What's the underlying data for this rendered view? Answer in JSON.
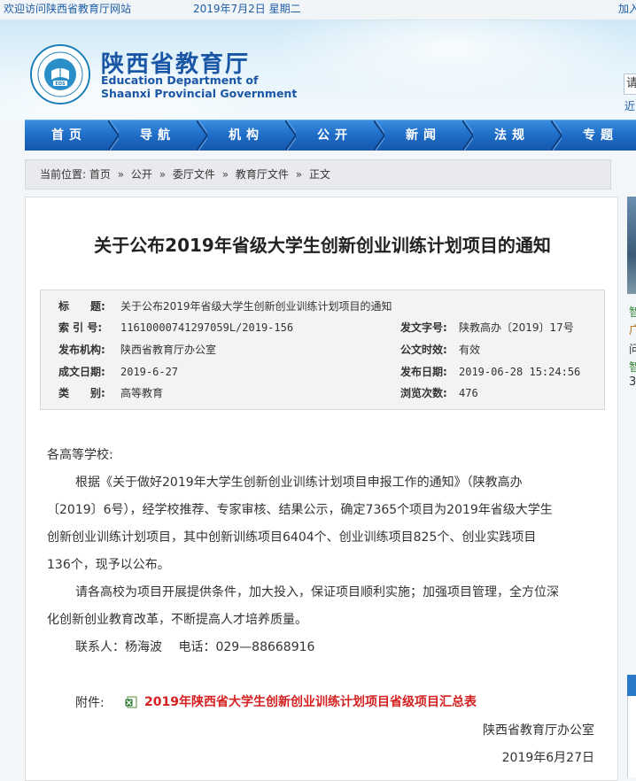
{
  "topbar": {
    "welcome": "欢迎访问陕西省教育厅网站",
    "date": "2019年7月2日 星期二",
    "right_fragment": "加入"
  },
  "header": {
    "site_name_cn": "陕西省教育厅",
    "site_name_en_1": "Education Department of",
    "site_name_en_2": "Shaanxi Provincial Government",
    "logo_text_top": "EDUCATION DEPARTMENT OF SHAANXI",
    "logo_badge": "EDS",
    "logo_text_bottom": "陕西省教育厅",
    "search_fragment": "请",
    "hot_fragment": "近"
  },
  "nav": {
    "items": [
      "首页",
      "导航",
      "机构",
      "公开",
      "新闻",
      "法规",
      "专题"
    ]
  },
  "breadcrumb": {
    "prefix": "当前位置:",
    "items": [
      "首页",
      "公开",
      "委厅文件",
      "教育厅文件",
      "正文"
    ],
    "separator": "»"
  },
  "article": {
    "title": "关于公布2019年省级大学生创新创业训练计划项目的通知",
    "meta": {
      "title_label": "标　　题:",
      "title_value": "关于公布2019年省级大学生创新创业训练计划项目的通知",
      "index_label": "索 引 号:",
      "index_value": "11610000741297059L/2019-156",
      "doc_no_label": "发文字号:",
      "doc_no_value": "陕教高办〔2019〕17号",
      "issuer_label": "发布机构:",
      "issuer_value": "陕西省教育厅办公室",
      "validity_label": "公文时效:",
      "validity_value": "有效",
      "created_label": "成文日期:",
      "created_value": "2019-6-27",
      "published_label": "发布日期:",
      "published_value": "2019-06-28 15:24:56",
      "category_label": "类　　别:",
      "category_value": "高等教育",
      "views_label": "浏览次数:",
      "views_value": "476"
    },
    "body": {
      "salutation": "各高等学校:",
      "p1_l1": "根据《关于做好2019年大学生创新创业训练计划项目申报工作的通知》（陕教高办",
      "p1_l2": "〔2019〕6号），经学校推荐、专家审核、结果公示，确定7365个项目为2019年省级大学生",
      "p1_l3": "创新创业训练计划项目，其中创新训练项目6404个、创业训练项目825个、创业实践项目",
      "p1_l4": "136个，现予以公布。",
      "p2_l1": "请各高校为项目开展提供条件，加大投入，保证项目顺利实施；加强项目管理，全方位深",
      "p2_l2": "化创新创业教育改革，不断提高人才培养质量。",
      "contact": "联系人：杨海波　 电话：029—88668916",
      "attachment_label": "附件:",
      "attachment_icon": "excel-file-icon",
      "attachment_title": "2019年陕西省大学生创新创业训练计划项目省级项目汇总表",
      "signature_org": "陕西省教育厅办公室",
      "signature_date": "2019年6月27日"
    }
  },
  "colors": {
    "brand_blue": "#1a56a6",
    "nav_blue": "#1e6cc6",
    "link_red": "#d42020"
  }
}
